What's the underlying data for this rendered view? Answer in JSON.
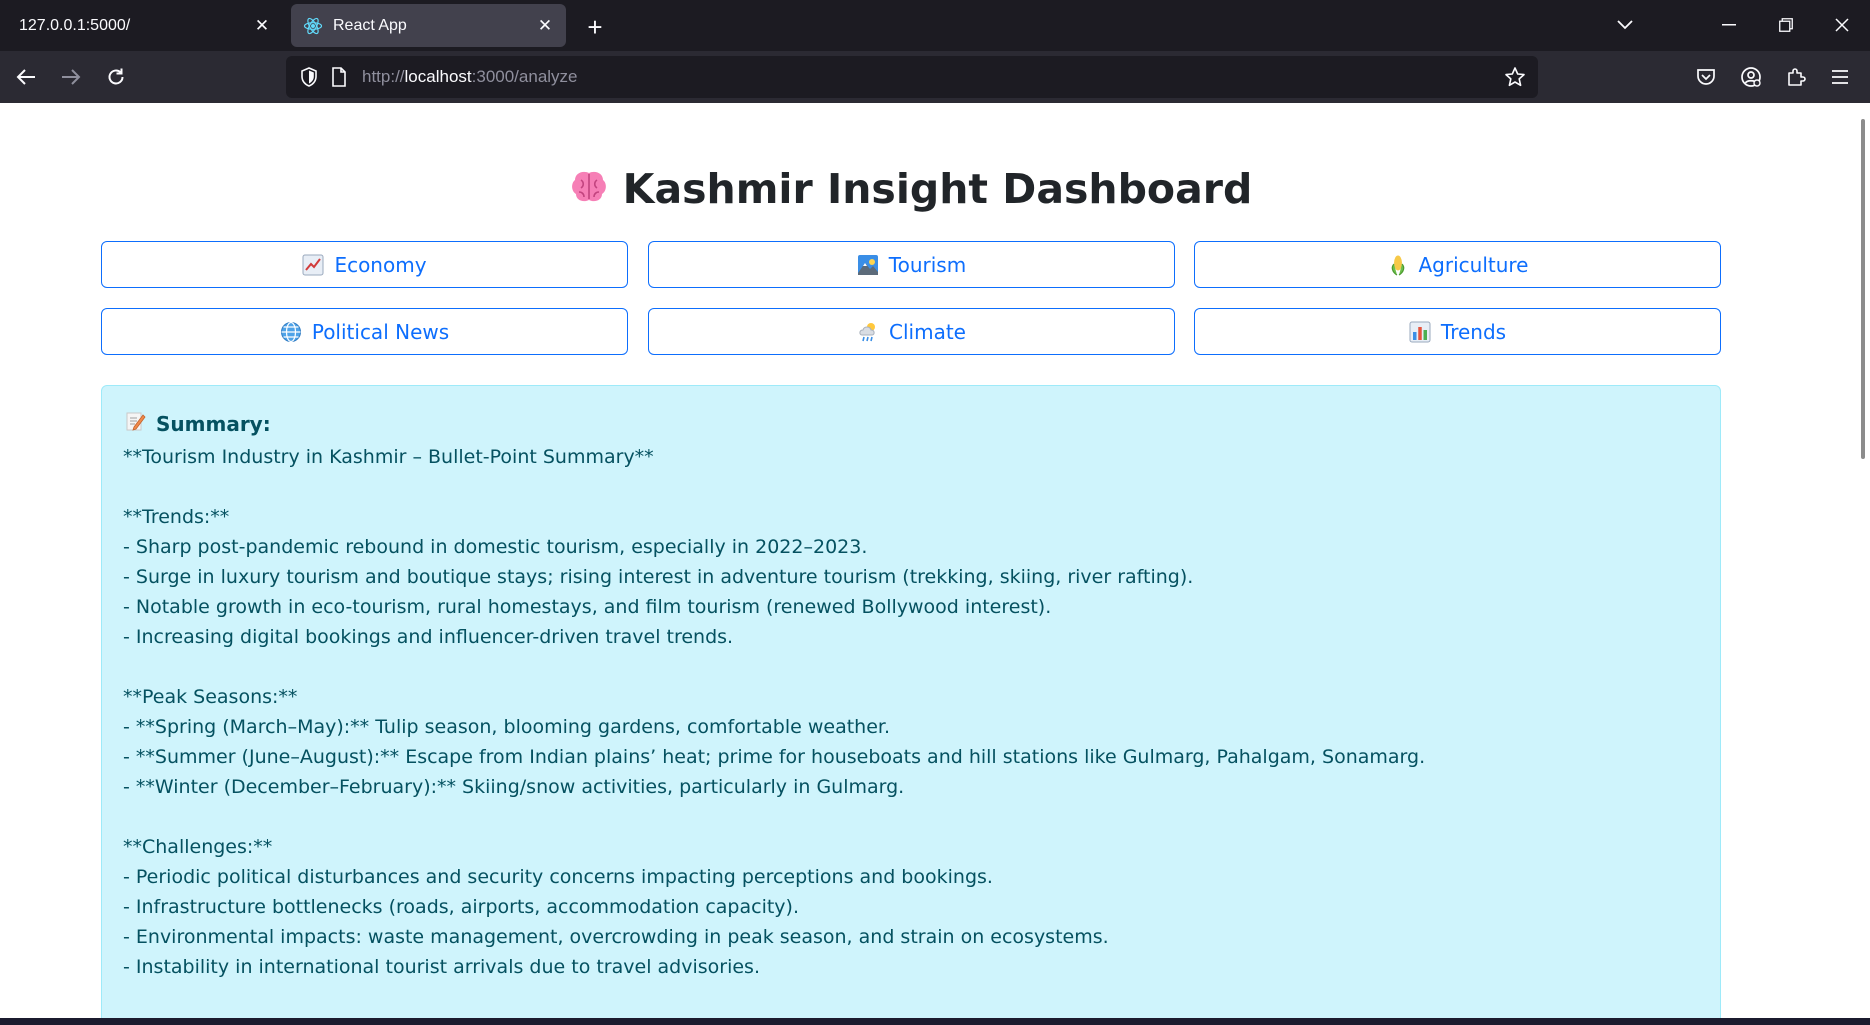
{
  "browser": {
    "tabs": [
      {
        "title": "127.0.0.1:5000/",
        "active": false
      },
      {
        "title": "React App",
        "active": true
      }
    ],
    "url": {
      "scheme": "http://",
      "host": "localhost",
      "path": ":3000/analyze"
    },
    "colors": {
      "tabbar": "#1c1b22",
      "navbar": "#2b2a33",
      "accent": "#0d6efd"
    }
  },
  "page": {
    "title": "Kashmir Insight Dashboard",
    "title_icon": "brain-icon",
    "buttons": [
      {
        "label": "Economy",
        "icon": "chart-increasing-icon"
      },
      {
        "label": "Tourism",
        "icon": "sunrise-over-mountains-icon"
      },
      {
        "label": "Agriculture",
        "icon": "corn-icon"
      },
      {
        "label": "Political News",
        "icon": "globe-icon"
      },
      {
        "label": "Climate",
        "icon": "cloud-rain-icon"
      },
      {
        "label": "Trends",
        "icon": "bar-chart-icon"
      }
    ],
    "summary": {
      "heading": "Summary:",
      "heading_icon": "memo-icon",
      "text": "**Tourism Industry in Kashmir – Bullet-Point Summary**\n\n**Trends:**\n- Sharp post-pandemic rebound in domestic tourism, especially in 2022–2023.\n- Surge in luxury tourism and boutique stays; rising interest in adventure tourism (trekking, skiing, river rafting).\n- Notable growth in eco-tourism, rural homestays, and film tourism (renewed Bollywood interest).\n- Increasing digital bookings and influencer-driven travel trends.\n\n**Peak Seasons:**\n- **Spring (March–May):** Tulip season, blooming gardens, comfortable weather.\n- **Summer (June–August):** Escape from Indian plains’ heat; prime for houseboats and hill stations like Gulmarg, Pahalgam, Sonamarg.\n- **Winter (December–February):** Skiing/snow activities, particularly in Gulmarg.\n\n**Challenges:**\n- Periodic political disturbances and security concerns impacting perceptions and bookings.\n- Infrastructure bottlenecks (roads, airports, accommodation capacity).\n- Environmental impacts: waste management, overcrowding in peak season, and strain on ecosystems.\n- Instability in international tourist arrivals due to travel advisories."
    }
  }
}
